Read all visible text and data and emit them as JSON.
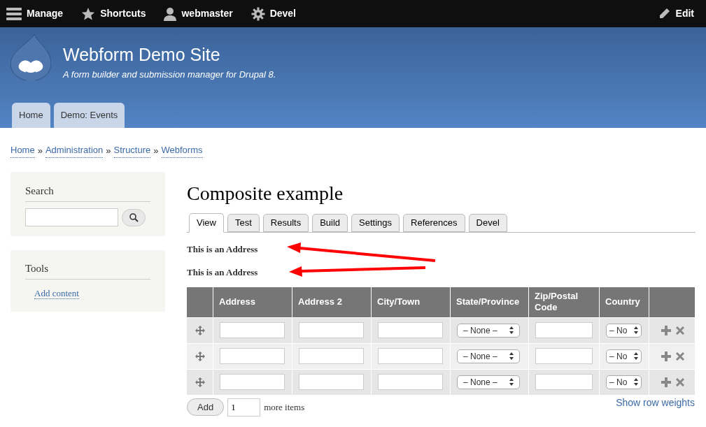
{
  "toolbar": {
    "items": [
      {
        "kind": "menu",
        "label": "Manage"
      },
      {
        "kind": "star",
        "label": "Shortcuts"
      },
      {
        "kind": "user",
        "label": "webmaster"
      },
      {
        "kind": "gear",
        "label": "Devel"
      }
    ],
    "edit": "Edit"
  },
  "header": {
    "site_name": "Webform Demo Site",
    "slogan": "A form builder and submission manager for Drupal 8.",
    "tabs": [
      {
        "label": "Home",
        "selected": false
      },
      {
        "label": "Demo: Events",
        "selected": false
      }
    ]
  },
  "breadcrumb": {
    "links": [
      "Home",
      "Administration",
      "Structure",
      "Webforms"
    ],
    "separators": [
      "»",
      "»",
      "»"
    ]
  },
  "sidebar": {
    "search": {
      "title": "Search"
    },
    "tools": {
      "title": "Tools",
      "links": [
        "Add content"
      ]
    }
  },
  "page_title": "Composite example",
  "tabs": [
    {
      "label": "View",
      "selected": true
    },
    {
      "label": "Test",
      "selected": false
    },
    {
      "label": "Results",
      "selected": false
    },
    {
      "label": "Build",
      "selected": false
    },
    {
      "label": "Settings",
      "selected": false
    },
    {
      "label": "References",
      "selected": false
    },
    {
      "label": "Devel",
      "selected": false
    }
  ],
  "labels": [
    "This is an Address",
    "This is an Address"
  ],
  "table": {
    "columns": [
      "Address",
      "Address 2",
      "City/Town",
      "State/Province",
      "Zip/Postal Code",
      "Country"
    ],
    "rows": [
      {
        "state": "– None –",
        "country": "– No"
      },
      {
        "state": "– None –",
        "country": "– No"
      },
      {
        "state": "– None –",
        "country": "– No"
      }
    ]
  },
  "add": {
    "button": "Add",
    "count": "1",
    "suffix": "more items"
  },
  "show_weights": "Show row weights"
}
